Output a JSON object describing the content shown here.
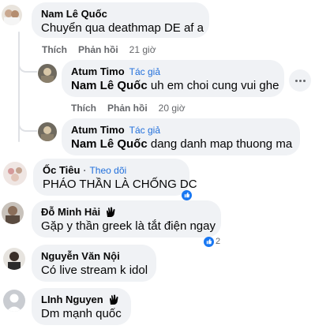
{
  "comments": [
    {
      "author": "Nam Lê Quốc",
      "text": "Chuyển qua deathmap DE af a",
      "actions": {
        "like": "Thích",
        "reply": "Phản hồi",
        "time": "21 giờ"
      }
    },
    {
      "author": "Atum Timo",
      "tag": "Tác giả",
      "mention": "Nam Lê Quốc",
      "text": " uh em choi cung vui ghe",
      "actions": {
        "like": "Thích",
        "reply": "Phản hồi",
        "time": "20 giờ"
      }
    },
    {
      "author": "Atum Timo",
      "tag": "Tác giả",
      "mention": "Nam Lê Quốc",
      "text": " dang danh map thuong ma"
    },
    {
      "author": "Ốc Tiêu",
      "follow": "Theo dõi",
      "text": "PHÁO THẦN LÀ CHỐNG DC"
    },
    {
      "author": "Đỗ Minh Hải",
      "text": "Gặp y thần greek là tắt điện ngay",
      "reaction_count": "2"
    },
    {
      "author": "Nguyễn Văn Nội",
      "text": "Có live stream k idol"
    },
    {
      "author": "LInh Nguyen",
      "text": "Dm mạnh quốc"
    }
  ],
  "colors": {
    "bubble": "#f0f2f5",
    "link": "#216fdb",
    "muted": "#65676b",
    "text": "#050505"
  },
  "icons": [
    "more-options-icon",
    "fan-badge-icon",
    "like-reaction-icon"
  ]
}
